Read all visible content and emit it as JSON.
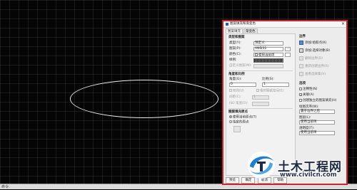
{
  "dialog": {
    "title": "图案填充和渐变色",
    "close_glyph": "×",
    "tabs": [
      "图案填充",
      "渐变色"
    ],
    "left": {
      "type_group": "类型和图案",
      "type_label": "类型(Y):",
      "type_value": "预定义",
      "pattern_label": "图案(P):",
      "pattern_value": "ANSI31",
      "color_label": "颜色(C):",
      "color_value": "使用当前项",
      "sample_label": "样例:",
      "custom_label": "自定义图案(M):",
      "angle_group": "角度和比例",
      "angle_label": "角度(G):",
      "angle_value": "0",
      "scale_label": "比例(S):",
      "scale_value": "1",
      "double_label": "双向(U)",
      "relative_label": "相对图纸空间(E)",
      "spacing_label": "间距(C):",
      "spacing_value": "1",
      "iso_label": "ISO 笔宽(O):",
      "origin_group": "图案填充原点",
      "origin_current": "使用当前原点(T)",
      "origin_specified": "指定的原点"
    },
    "right": {
      "boundary_group": "边界",
      "add_pick": "添加:拾取点(K)",
      "add_select": "添加:选择对象(B)",
      "remove_boundary": "删除边界(D)",
      "recreate_boundary": "重新创建边界(R)",
      "view_selection": "查看选择集(V)",
      "options_group": "选项",
      "annotative": "注释性(N)",
      "associative": "关联(A)",
      "separate": "创建独立的图案填充(H)",
      "draw_order_label": "绘图次序(W):",
      "draw_order_value": "置于边界之后",
      "layer_label": "图层(L):",
      "layer_value": "使用当前项",
      "transparency_label": "透明度(T):",
      "transparency_value": "使用当前项"
    },
    "footer": {
      "preview": "预览",
      "ok": "确定",
      "cancel": "取消",
      "help": "帮助"
    }
  },
  "statusbar": {
    "text": "命令:"
  },
  "watermark": {
    "title": "土木工程网",
    "url": "www.civilcn.com"
  },
  "colors": {
    "dialog_border": "#d1232a",
    "canvas": "#050505",
    "ellipse": "#e9e9e9"
  }
}
